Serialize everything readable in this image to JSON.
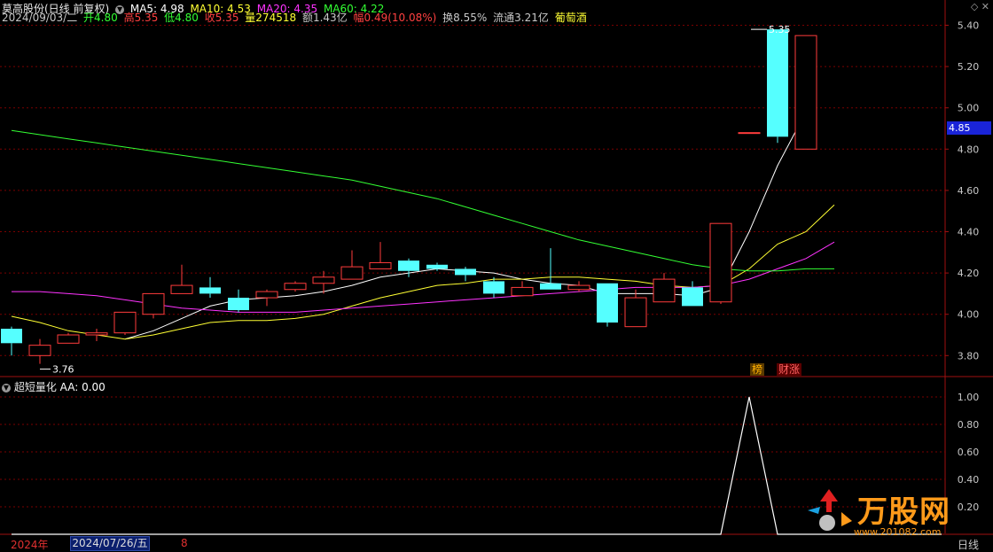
{
  "header": {
    "stock": "莫高股份(日线 前复权)",
    "ma": [
      {
        "label": "MA5: 4.98",
        "color": "#ffffff"
      },
      {
        "label": "MA10: 4.53",
        "color": "#ffff33"
      },
      {
        "label": "MA20: 4.35",
        "color": "#ff33ff"
      },
      {
        "label": "MA60: 4.22",
        "color": "#33ff33"
      }
    ],
    "date": "2024/09/03/二",
    "open": "开4.80",
    "high": "高5.35",
    "low": "低4.80",
    "close": "收5.35",
    "vol": "量274518",
    "amount": "额1.43亿",
    "change": "幅0.49(10.08%)",
    "turnover": "换8.55%",
    "float": "流通3.21亿",
    "concept": "葡萄酒"
  },
  "indicator": {
    "name": "超短量化",
    "value": "AA: 0.00"
  },
  "footer": {
    "year": "2024年",
    "date": "2024/07/26/五",
    "mark": "8",
    "period": "日线"
  },
  "current_price": "4.85",
  "tags": {
    "bang": "榜",
    "cai": "财涨"
  },
  "logo": {
    "text": "万股网",
    "url": "www.201082.com"
  },
  "annotations": {
    "low_label": "3.76",
    "high_label": "5.35"
  },
  "colors": {
    "up": "#ff3c3c",
    "down": "#55ffff",
    "grid": "#7a0000",
    "axis": "#a01010"
  },
  "chart_data": {
    "type": "candlestick",
    "title": "莫高股份(日线 前复权)",
    "price_range": [
      3.7,
      5.45
    ],
    "y_ticks": [
      3.8,
      4.0,
      4.2,
      4.4,
      4.6,
      4.8,
      5.0,
      5.2,
      5.4
    ],
    "candles": [
      {
        "o": 3.93,
        "c": 3.86,
        "h": 3.94,
        "l": 3.8
      },
      {
        "o": 3.8,
        "c": 3.85,
        "h": 3.88,
        "l": 3.76
      },
      {
        "o": 3.86,
        "c": 3.9,
        "h": 3.91,
        "l": 3.86
      },
      {
        "o": 3.9,
        "c": 3.91,
        "h": 3.93,
        "l": 3.87
      },
      {
        "o": 3.91,
        "c": 4.01,
        "h": 4.01,
        "l": 3.9
      },
      {
        "o": 4.0,
        "c": 4.1,
        "h": 4.1,
        "l": 3.98
      },
      {
        "o": 4.1,
        "c": 4.14,
        "h": 4.24,
        "l": 4.1
      },
      {
        "o": 4.13,
        "c": 4.1,
        "h": 4.18,
        "l": 4.08
      },
      {
        "o": 4.08,
        "c": 4.02,
        "h": 4.12,
        "l": 4.01
      },
      {
        "o": 4.08,
        "c": 4.11,
        "h": 4.12,
        "l": 4.04
      },
      {
        "o": 4.12,
        "c": 4.15,
        "h": 4.16,
        "l": 4.11
      },
      {
        "o": 4.15,
        "c": 4.18,
        "h": 4.21,
        "l": 4.1
      },
      {
        "o": 4.17,
        "c": 4.23,
        "h": 4.31,
        "l": 4.17
      },
      {
        "o": 4.22,
        "c": 4.25,
        "h": 4.35,
        "l": 4.22
      },
      {
        "o": 4.26,
        "c": 4.21,
        "h": 4.27,
        "l": 4.18
      },
      {
        "o": 4.24,
        "c": 4.22,
        "h": 4.25,
        "l": 4.21
      },
      {
        "o": 4.22,
        "c": 4.19,
        "h": 4.23,
        "l": 4.16
      },
      {
        "o": 4.16,
        "c": 4.1,
        "h": 4.18,
        "l": 4.08
      },
      {
        "o": 4.09,
        "c": 4.13,
        "h": 4.16,
        "l": 4.09
      },
      {
        "o": 4.15,
        "c": 4.12,
        "h": 4.32,
        "l": 4.12
      },
      {
        "o": 4.12,
        "c": 4.14,
        "h": 4.16,
        "l": 4.11
      },
      {
        "o": 4.15,
        "c": 3.96,
        "h": 4.15,
        "l": 3.94
      },
      {
        "o": 3.94,
        "c": 4.08,
        "h": 4.12,
        "l": 3.94
      },
      {
        "o": 4.06,
        "c": 4.17,
        "h": 4.2,
        "l": 4.06
      },
      {
        "o": 4.13,
        "c": 4.04,
        "h": 4.16,
        "l": 4.04
      },
      {
        "o": 4.06,
        "c": 4.44,
        "h": 4.44,
        "l": 4.05
      },
      {
        "o": 4.88,
        "c": 4.88,
        "h": 4.88,
        "l": 4.88
      },
      {
        "o": 5.38,
        "c": 4.86,
        "h": 5.38,
        "l": 4.83
      },
      {
        "o": 4.8,
        "c": 5.35,
        "h": 5.35,
        "l": 4.8
      }
    ],
    "ma_series": [
      {
        "name": "MA5",
        "color": "#ffffff",
        "values": [
          null,
          null,
          null,
          null,
          3.88,
          3.92,
          3.98,
          4.04,
          4.07,
          4.08,
          4.09,
          4.11,
          4.14,
          4.18,
          4.2,
          4.22,
          4.21,
          4.2,
          4.17,
          4.15,
          4.14,
          4.1,
          4.1,
          4.1,
          4.09,
          4.13,
          4.4,
          4.72,
          4.98
        ]
      },
      {
        "name": "MA10",
        "color": "#ffff33",
        "values": [
          3.99,
          3.96,
          3.92,
          3.9,
          3.88,
          3.9,
          3.93,
          3.96,
          3.97,
          3.97,
          3.98,
          4.0,
          4.04,
          4.08,
          4.11,
          4.14,
          4.15,
          4.17,
          4.17,
          4.18,
          4.18,
          4.17,
          4.16,
          4.14,
          4.13,
          4.14,
          4.22,
          4.34,
          4.4,
          4.53
        ]
      },
      {
        "name": "MA20",
        "color": "#ff33ff",
        "values": [
          4.11,
          4.11,
          4.1,
          4.09,
          4.07,
          4.05,
          4.03,
          4.02,
          4.01,
          4.01,
          4.01,
          4.02,
          4.03,
          4.04,
          4.05,
          4.06,
          4.07,
          4.08,
          4.09,
          4.1,
          4.11,
          4.12,
          4.13,
          4.13,
          4.13,
          4.14,
          4.17,
          4.22,
          4.27,
          4.35
        ]
      },
      {
        "name": "MA60",
        "color": "#33ff33",
        "values": [
          4.89,
          4.87,
          4.85,
          4.83,
          4.81,
          4.79,
          4.77,
          4.75,
          4.73,
          4.71,
          4.69,
          4.67,
          4.65,
          4.62,
          4.59,
          4.56,
          4.52,
          4.48,
          4.44,
          4.4,
          4.36,
          4.33,
          4.3,
          4.27,
          4.24,
          4.22,
          4.21,
          4.21,
          4.22,
          4.22
        ]
      }
    ],
    "indicator": {
      "name": "超短量化",
      "series": "AA",
      "y_ticks": [
        0.2,
        0.4,
        0.6,
        0.8,
        1.0
      ],
      "range": [
        0,
        1.05
      ],
      "values": [
        0,
        0,
        0,
        0,
        0,
        0,
        0,
        0,
        0,
        0,
        0,
        0,
        0,
        0,
        0,
        0,
        0,
        0,
        0,
        0,
        0,
        0,
        0,
        0,
        0,
        0,
        1,
        0,
        0
      ]
    }
  }
}
